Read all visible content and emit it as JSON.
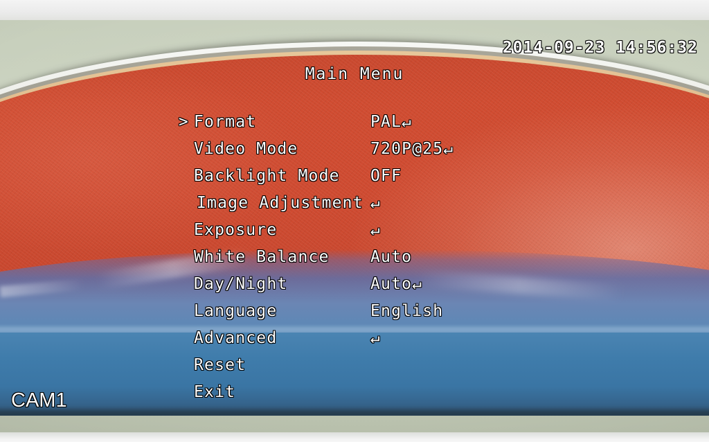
{
  "osd": {
    "timestamp": "2014-09-23 14:56:32",
    "camera_label": "CAM1",
    "title": "Main Menu",
    "cursor_glyph": ">",
    "submenu_glyph": "↵",
    "selected_index": 0,
    "text_color": "#ffffff",
    "outline_color": "#000000"
  },
  "menu": {
    "items": [
      {
        "label": "Format",
        "value": "PAL↵",
        "cursor": ">",
        "indented": false
      },
      {
        "label": "Video Mode",
        "value": "720P@25↵",
        "cursor": "",
        "indented": false
      },
      {
        "label": "Backlight Mode",
        "value": "OFF",
        "cursor": "",
        "indented": false
      },
      {
        "label": "Image Adjustment",
        "value": "↵",
        "cursor": "",
        "indented": true
      },
      {
        "label": "Exposure",
        "value": "↵",
        "cursor": "",
        "indented": false
      },
      {
        "label": "White Balance",
        "value": "Auto",
        "cursor": "",
        "indented": false
      },
      {
        "label": "Day/Night",
        "value": "Auto↵",
        "cursor": "",
        "indented": false
      },
      {
        "label": "Language",
        "value": "English",
        "cursor": "",
        "indented": false
      },
      {
        "label": "Advanced",
        "value": "↵",
        "cursor": "",
        "indented": false
      },
      {
        "label": "Reset",
        "value": "",
        "cursor": "",
        "indented": false
      },
      {
        "label": "Exit",
        "value": "",
        "cursor": "",
        "indented": false
      }
    ]
  },
  "scene": {
    "lid_color": "#cc4a30",
    "box_color": "#3f7cab",
    "surface_color": "#c7cfbc",
    "letterbox_color": "#f2f2f2"
  }
}
